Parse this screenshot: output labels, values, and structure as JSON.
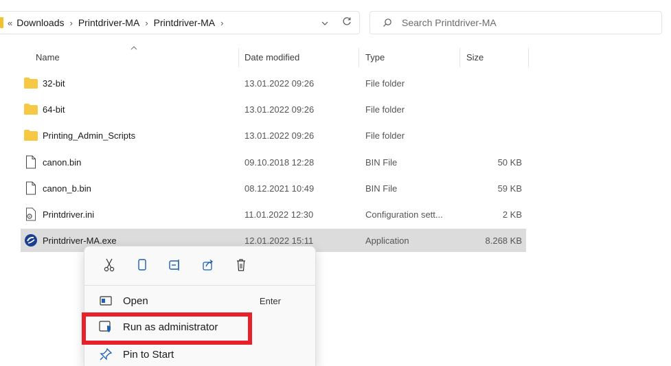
{
  "address": {
    "lead": "«",
    "crumbs": [
      "Downloads",
      "Printdriver-MA",
      "Printdriver-MA"
    ],
    "trailing_sep": "›",
    "dropdown_icon": "chevron-down-icon",
    "refresh_icon": "refresh-icon"
  },
  "search": {
    "placeholder": "Search Printdriver-MA"
  },
  "columns": {
    "name": "Name",
    "date": "Date modified",
    "type": "Type",
    "size": "Size"
  },
  "files": [
    {
      "name": "32-bit",
      "date": "13.01.2022 09:26",
      "type": "File folder",
      "size": "",
      "icon": "folder-icon"
    },
    {
      "name": "64-bit",
      "date": "13.01.2022 09:26",
      "type": "File folder",
      "size": "",
      "icon": "folder-icon"
    },
    {
      "name": "Printing_Admin_Scripts",
      "date": "13.01.2022 09:26",
      "type": "File folder",
      "size": "",
      "icon": "folder-icon"
    },
    {
      "name": "canon.bin",
      "date": "09.10.2018 12:28",
      "type": "BIN File",
      "size": "50 KB",
      "icon": "file-icon"
    },
    {
      "name": "canon_b.bin",
      "date": "08.12.2021 10:49",
      "type": "BIN File",
      "size": "59 KB",
      "icon": "file-icon"
    },
    {
      "name": "Printdriver.ini",
      "date": "11.01.2022 12:30",
      "type": "Configuration sett...",
      "size": "2 KB",
      "icon": "settings-file-icon"
    },
    {
      "name": "Printdriver-MA.exe",
      "date": "12.01.2022 15:11",
      "type": "Application",
      "size": "8.268 KB",
      "icon": "app-icon"
    }
  ],
  "context_menu": {
    "tools": [
      "cut-icon",
      "copy-icon",
      "rename-icon",
      "share-icon",
      "delete-icon"
    ],
    "items": [
      {
        "label": "Open",
        "shortcut": "Enter",
        "icon": "open-icon"
      },
      {
        "label": "Run as administrator",
        "shortcut": "",
        "icon": "shield-icon"
      },
      {
        "label": "Pin to Start",
        "shortcut": "",
        "icon": "pin-icon"
      }
    ]
  },
  "colors": {
    "highlight": "#e8202c",
    "folder": "#f7c843",
    "selected_row": "#dcdcdc"
  }
}
